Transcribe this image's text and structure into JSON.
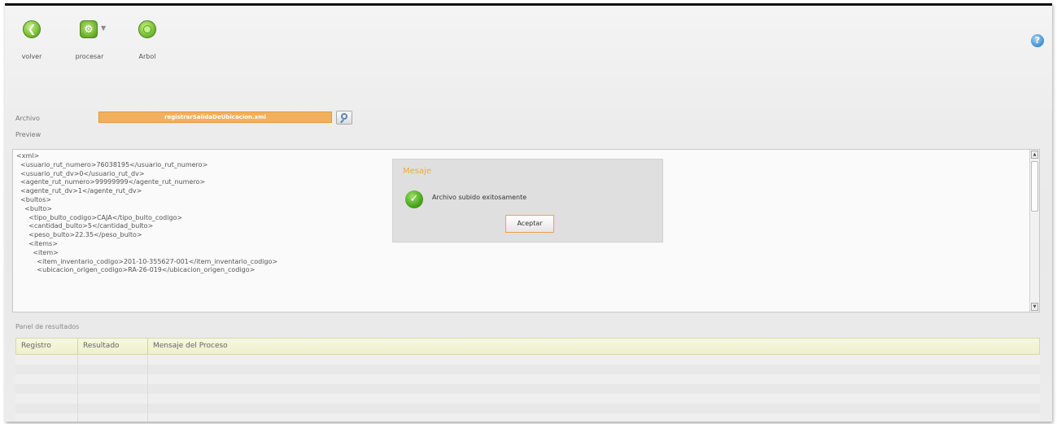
{
  "toolbar": {
    "items": [
      {
        "label": "volver",
        "icon": "back-arrow-icon"
      },
      {
        "label": "procesar",
        "icon": "gear-icon"
      },
      {
        "label": "Arbol",
        "icon": "tree-icon"
      }
    ]
  },
  "help": {
    "icon": "help-icon"
  },
  "form": {
    "archivo_label": "Archivo",
    "archivo_value": "registrarSalidaDeUbicacion.xml",
    "preview_label": "Preview"
  },
  "preview": {
    "lines": [
      "<xml>",
      "  <usuario_rut_numero>76038195</usuario_rut_numero>",
      "  <usuario_rut_dv>0</usuario_rut_dv>",
      "  <agente_rut_numero>99999999</agente_rut_numero>",
      "  <agente_rut_dv>1</agente_rut_dv>",
      "  <bultos>",
      "    <bulto>",
      "      <tipo_bulto_codigo>CAJA</tipo_bulto_codigo>",
      "      <cantidad_bulto>5</cantidad_bulto>",
      "      <peso_bulto>22.35</peso_bulto>",
      "      <items>",
      "        <item>",
      "          <item_inventario_codigo>201-10-355627-001</item_inventario_codigo>",
      "          <ubicacion_origen_codigo>RA-26-019</ubicacion_origen_codigo>"
    ]
  },
  "dialog": {
    "title": "Mesaje",
    "message": "Archivo subido exitosamente",
    "button": "Aceptar"
  },
  "results": {
    "panel_label": "Panel de resultados",
    "columns": [
      "Registro",
      "Resultado",
      "Mensaje del Proceso"
    ]
  },
  "colors": {
    "accent": "#f0b05c",
    "green": "#6cae2c",
    "header_bg": "#eef0cb"
  }
}
